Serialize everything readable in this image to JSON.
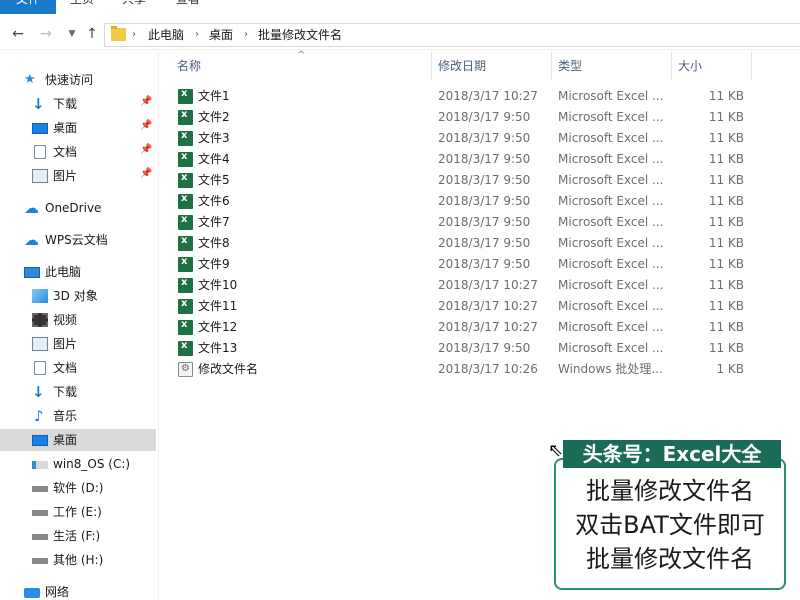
{
  "ribbon": {
    "tabs": [
      "文件",
      "主页",
      "共享",
      "查看"
    ]
  },
  "address": {
    "crumbs": [
      "此电脑",
      "桌面",
      "批量修改文件名"
    ]
  },
  "sidebar": {
    "items": [
      {
        "label": "快速访问",
        "icon": "star-icon"
      },
      {
        "label": "下载",
        "icon": "download-icon",
        "pinned": true
      },
      {
        "label": "桌面",
        "icon": "desktop-icon",
        "pinned": true
      },
      {
        "label": "文档",
        "icon": "document-icon",
        "pinned": true
      },
      {
        "label": "图片",
        "icon": "pictures-icon",
        "pinned": true
      },
      {
        "label": "OneDrive",
        "icon": "cloud-icon"
      },
      {
        "label": "WPS云文档",
        "icon": "wps-cloud-icon"
      },
      {
        "label": "此电脑",
        "icon": "pc-icon"
      },
      {
        "label": "3D 对象",
        "icon": "3d-objects-icon"
      },
      {
        "label": "视频",
        "icon": "video-icon"
      },
      {
        "label": "图片",
        "icon": "pictures-icon"
      },
      {
        "label": "文档",
        "icon": "document-icon"
      },
      {
        "label": "下载",
        "icon": "download-icon"
      },
      {
        "label": "音乐",
        "icon": "music-icon"
      },
      {
        "label": "桌面",
        "icon": "desktop-icon",
        "selected": true
      },
      {
        "label": "win8_OS (C:)",
        "icon": "windows-drive-icon"
      },
      {
        "label": "软件 (D:)",
        "icon": "drive-icon"
      },
      {
        "label": "工作 (E:)",
        "icon": "drive-icon"
      },
      {
        "label": "生活 (F:)",
        "icon": "drive-icon"
      },
      {
        "label": "其他 (H:)",
        "icon": "drive-icon"
      },
      {
        "label": "网络",
        "icon": "network-icon"
      }
    ]
  },
  "columns": {
    "name": "名称",
    "date": "修改日期",
    "type": "类型",
    "size": "大小"
  },
  "files": [
    {
      "name": "文件1",
      "date": "2018/3/17 10:27",
      "type": "Microsoft Excel ...",
      "size": "11 KB",
      "icon": "excel-file-icon"
    },
    {
      "name": "文件2",
      "date": "2018/3/17 9:50",
      "type": "Microsoft Excel ...",
      "size": "11 KB",
      "icon": "excel-file-icon"
    },
    {
      "name": "文件3",
      "date": "2018/3/17 9:50",
      "type": "Microsoft Excel ...",
      "size": "11 KB",
      "icon": "excel-file-icon"
    },
    {
      "name": "文件4",
      "date": "2018/3/17 9:50",
      "type": "Microsoft Excel ...",
      "size": "11 KB",
      "icon": "excel-file-icon"
    },
    {
      "name": "文件5",
      "date": "2018/3/17 9:50",
      "type": "Microsoft Excel ...",
      "size": "11 KB",
      "icon": "excel-file-icon"
    },
    {
      "name": "文件6",
      "date": "2018/3/17 9:50",
      "type": "Microsoft Excel ...",
      "size": "11 KB",
      "icon": "excel-file-icon"
    },
    {
      "name": "文件7",
      "date": "2018/3/17 9:50",
      "type": "Microsoft Excel ...",
      "size": "11 KB",
      "icon": "excel-file-icon"
    },
    {
      "name": "文件8",
      "date": "2018/3/17 9:50",
      "type": "Microsoft Excel ...",
      "size": "11 KB",
      "icon": "excel-file-icon"
    },
    {
      "name": "文件9",
      "date": "2018/3/17 9:50",
      "type": "Microsoft Excel ...",
      "size": "11 KB",
      "icon": "excel-file-icon"
    },
    {
      "name": "文件10",
      "date": "2018/3/17 10:27",
      "type": "Microsoft Excel ...",
      "size": "11 KB",
      "icon": "excel-file-icon"
    },
    {
      "name": "文件11",
      "date": "2018/3/17 10:27",
      "type": "Microsoft Excel ...",
      "size": "11 KB",
      "icon": "excel-file-icon"
    },
    {
      "name": "文件12",
      "date": "2018/3/17 10:27",
      "type": "Microsoft Excel ...",
      "size": "11 KB",
      "icon": "excel-file-icon"
    },
    {
      "name": "文件13",
      "date": "2018/3/17 9:50",
      "type": "Microsoft Excel ...",
      "size": "11 KB",
      "icon": "excel-file-icon"
    },
    {
      "name": "修改文件名",
      "date": "2018/3/17 10:26",
      "type": "Windows 批处理...",
      "size": "1 KB",
      "icon": "batch-file-icon"
    }
  ],
  "watermark": {
    "title": "头条号：Excel大全",
    "lines": [
      "批量修改文件名",
      "双击BAT文件即可",
      "批量修改文件名"
    ]
  }
}
